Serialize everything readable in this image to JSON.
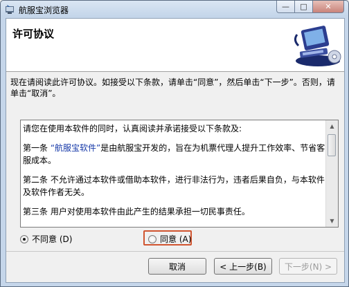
{
  "window": {
    "title": "航服宝浏览器",
    "controls": {
      "minimize": "—",
      "maximize": "□",
      "close": "✕"
    }
  },
  "header": {
    "title": "许可协议",
    "art_icon": "computer-setup-art-icon"
  },
  "intro": "现在请阅读此许可协议。如接受以下条款，请单击“同意”，然后单击“下一步”。否则，请单击“取消”。",
  "license": {
    "line1": "请您在使用本软件的同时，认真阅读并承诺接受以下条款及:",
    "item1_prefix": "第一条  ",
    "item1_link": "“航服宝软件”",
    "item1_rest": "是由航服宝开发的，旨在为机票代理人提升工作效率、节省客服成本。",
    "item2": "第二条   不允许通过本软件或借助本软件，进行非法行为，违者后果自负，与本软件及软件作者无关。",
    "item3": "第三条   用户对使用本软件由此产生的结果承担一切民事责任。"
  },
  "options": {
    "disagree": "不同意 (D)",
    "agree": "同意 (A)",
    "selected": "disagree"
  },
  "buttons": {
    "cancel": "取消",
    "back": "< 上一步(B)",
    "next": "下一步(N) >"
  },
  "colors": {
    "highlight_border": "#d0542f",
    "link": "#1538a8"
  }
}
